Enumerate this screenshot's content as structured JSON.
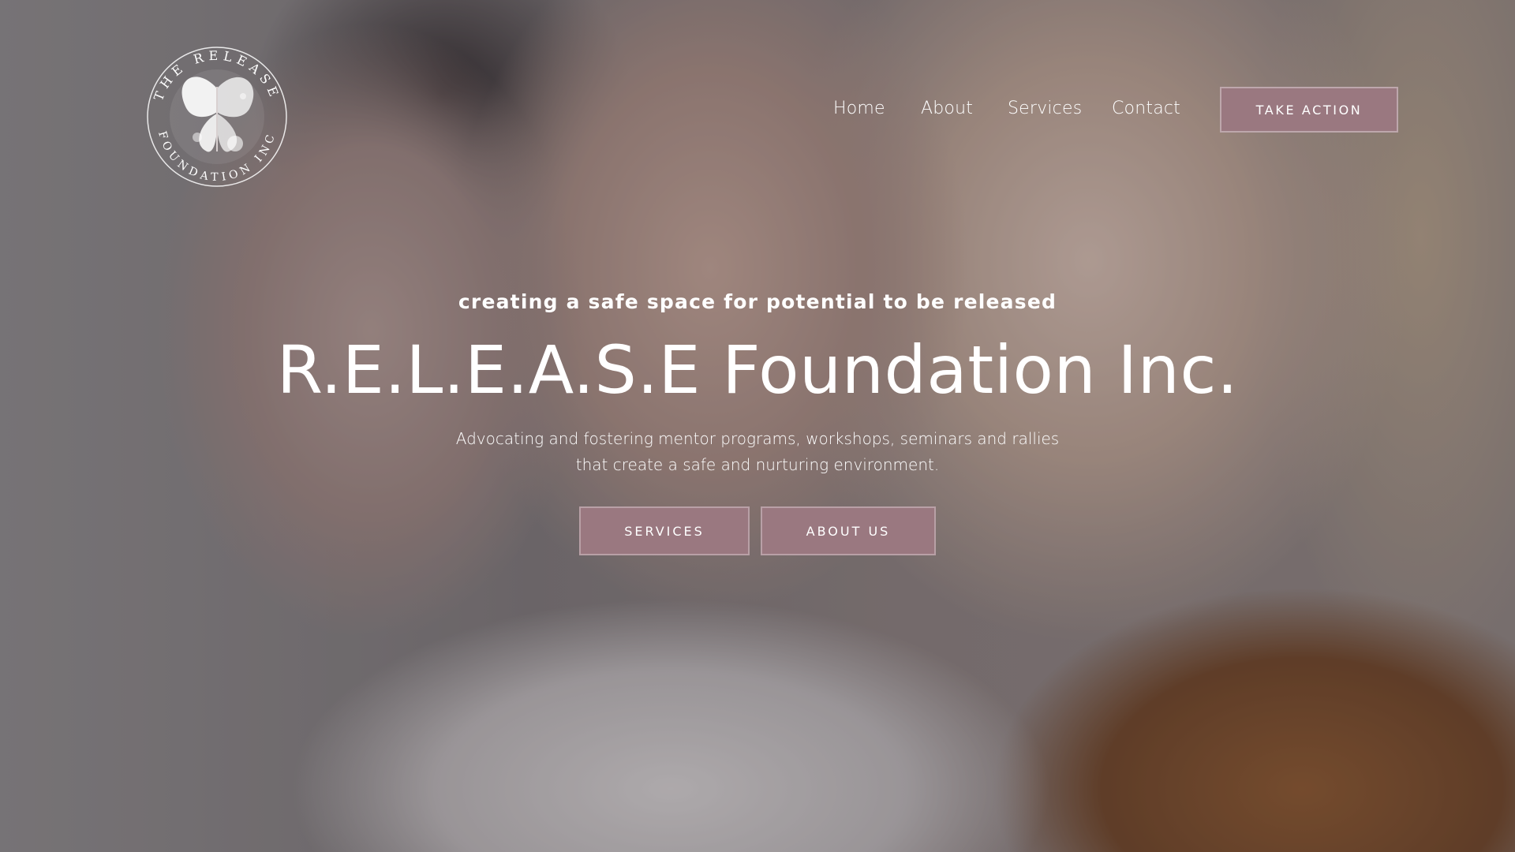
{
  "logo": {
    "text_top": "THE RELEASE",
    "text_bottom": "FOUNDATION INC"
  },
  "nav": {
    "items": [
      {
        "label": "Home"
      },
      {
        "label": "About"
      },
      {
        "label": "Services"
      },
      {
        "label": "Contact"
      }
    ],
    "cta_label": "TAKE ACTION"
  },
  "hero": {
    "tagline": "creating a safe space for potential to be released",
    "title": "R.E.L.E.A.S.E Foundation Inc.",
    "description_line1": "Advocating and fostering mentor programs, workshops, seminars and rallies",
    "description_line2": "that create a safe and nurturing environment.",
    "buttons": [
      {
        "label": "SERVICES"
      },
      {
        "label": "ABOUT US"
      }
    ]
  },
  "colors": {
    "accent": "#9a7880",
    "text": "#ffffff"
  }
}
